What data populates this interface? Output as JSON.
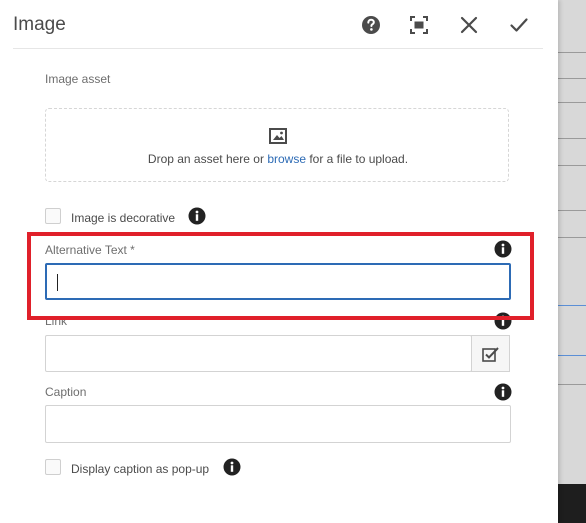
{
  "dialog": {
    "title": "Image",
    "header_icons": [
      "help-icon",
      "fullscreen-icon",
      "close-icon",
      "done-icon"
    ]
  },
  "image_asset": {
    "label": "Image asset",
    "drop_prefix": "Drop an asset here or ",
    "browse_link": "browse",
    "drop_suffix": " for a file to upload."
  },
  "decorative": {
    "label": "Image is decorative",
    "checked": false
  },
  "alt_text": {
    "label": "Alternative Text *",
    "value": ""
  },
  "link": {
    "label": "Link",
    "value": ""
  },
  "caption": {
    "label": "Caption",
    "value": ""
  },
  "popup": {
    "label": "Display caption as pop-up",
    "checked": false
  },
  "colors": {
    "accent": "#2d6bb5",
    "highlight": "#e0202a"
  }
}
